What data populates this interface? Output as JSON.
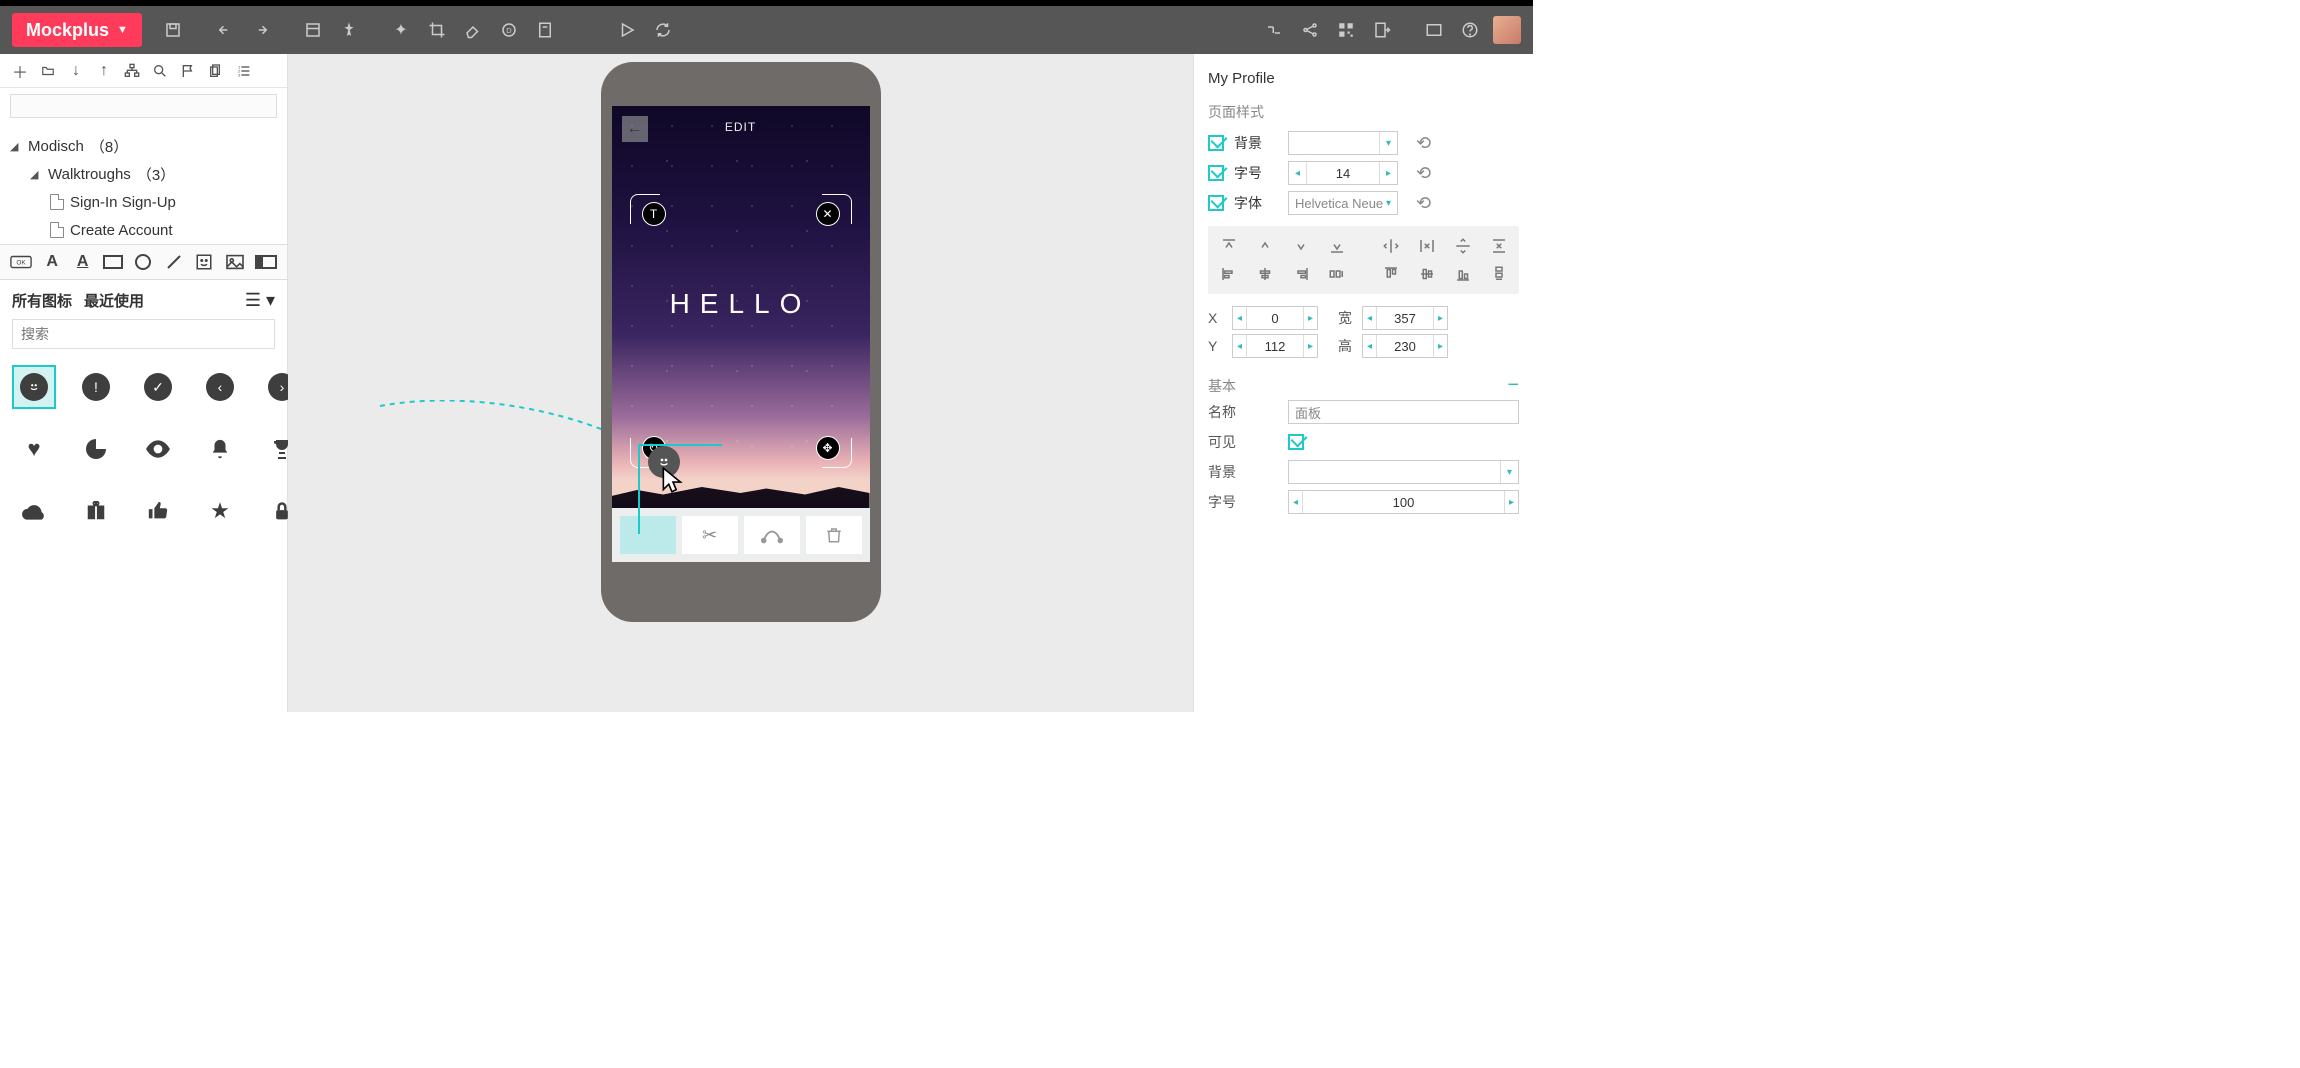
{
  "brand": "Mockplus",
  "tree": {
    "root_label": "Modisch",
    "root_count": "（8）",
    "group_label": "Walktroughs",
    "group_count": "（3）",
    "page1": "Sign-In Sign-Up",
    "page2": "Create Account"
  },
  "iconpicker": {
    "tab_all": "所有图标",
    "tab_recent": "最近使用",
    "search_placeholder": "搜索"
  },
  "mock": {
    "edit_label": "EDIT",
    "hello_text": "HELLO"
  },
  "inspector": {
    "title": "My Profile",
    "page_style_label": "页面样式",
    "bg_label": "背景",
    "fontsize_label": "字号",
    "fontsize_value": "14",
    "font_label": "字体",
    "font_value": "Helvetica Neue",
    "x_label": "X",
    "x_value": "0",
    "y_label": "Y",
    "y_value": "112",
    "w_label": "宽",
    "w_value": "357",
    "h_label": "高",
    "h_value": "230",
    "basic_label": "基本",
    "name_label": "名称",
    "name_value": "面板",
    "visible_label": "可见",
    "bg2_label": "背景",
    "fs2_label": "字号",
    "fs2_value": "100"
  }
}
